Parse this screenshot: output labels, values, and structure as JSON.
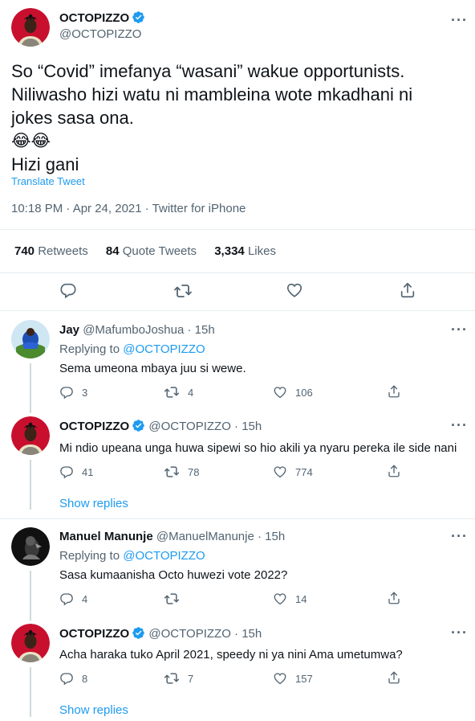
{
  "main": {
    "name": "OCTOPIZZO",
    "handle": "@OCTOPIZZO",
    "text_line1": "So “Covid” imefanya “wasani” wakue opportunists.",
    "text_line2": "Niliwasho hizi watu ni mambleina wote mkadhani ni",
    "text_line3": "jokes sasa ona.",
    "text_emoji": "😂😂",
    "text_line5": "Hizi gani",
    "translate": "Translate Tweet",
    "meta": "10:18 PM · Apr 24, 2021 · Twitter for iPhone",
    "retweets_count": "740",
    "retweets_label": "Retweets",
    "quotes_count": "84",
    "quotes_label": "Quote Tweets",
    "likes_count": "3,334",
    "likes_label": "Likes"
  },
  "replies": [
    {
      "name": "Jay",
      "handle": "@MafumboJoshua",
      "time": "· 15h",
      "replying_prefix": "Replying to",
      "replying_to": "@OCTOPIZZO",
      "text": "Sema umeona mbaya juu si wewe.",
      "replies": "3",
      "retweets": "4",
      "likes": "106"
    },
    {
      "name": "OCTOPIZZO",
      "handle": "@OCTOPIZZO",
      "time": "· 15h",
      "text": "Mi ndio upeana unga huwa sipewi so hio akili ya nyaru pereka ile side nani",
      "replies": "41",
      "retweets": "78",
      "likes": "774",
      "show_replies": "Show replies"
    },
    {
      "name": "Manuel Manunje",
      "handle": "@ManuelManunje",
      "time": "· 15h",
      "replying_prefix": "Replying to",
      "replying_to": "@OCTOPIZZO",
      "text": "Sasa kumaanisha Octo huwezi vote 2022?",
      "replies": "4",
      "retweets": "",
      "likes": "14"
    },
    {
      "name": "OCTOPIZZO",
      "handle": "@OCTOPIZZO",
      "time": "· 15h",
      "text": "Acha haraka tuko April 2021, speedy ni ya nini Ama umetumwa?",
      "replies": "8",
      "retweets": "7",
      "likes": "157",
      "show_replies": "Show replies"
    }
  ],
  "colors": {
    "accent": "#1d9bf0",
    "secondary_text": "#536471",
    "divider": "#e6ecf0"
  },
  "icons": [
    "verified-badge-icon",
    "more-icon",
    "reply-icon",
    "retweet-icon",
    "like-icon",
    "share-icon"
  ]
}
